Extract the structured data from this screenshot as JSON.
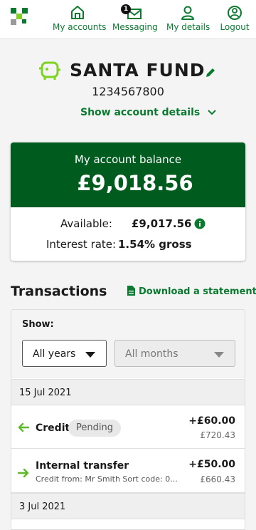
{
  "nav": {
    "items": [
      {
        "label": "My accounts",
        "icon": "home-icon"
      },
      {
        "label": "Messaging",
        "icon": "envelope-icon",
        "badge": "1"
      },
      {
        "label": "My details",
        "icon": "person-icon"
      },
      {
        "label": "Logout",
        "icon": "logout-icon"
      }
    ]
  },
  "account": {
    "name": "SANTA FUND",
    "number": "1234567800",
    "show_details": "Show account details"
  },
  "balance": {
    "label": "My account balance",
    "value": "£9,018.56",
    "available_label": "Available:",
    "available_value": "£9,017.56",
    "interest_label": "Interest rate:",
    "interest_value": "1.54% gross"
  },
  "transactions": {
    "title": "Transactions",
    "download": "Download a statement",
    "filter": {
      "show_label": "Show:",
      "years": "All years",
      "months": "All months"
    },
    "groups": [
      {
        "date": "15 Jul 2021",
        "items": [
          {
            "name": "Credit",
            "status": "Pending",
            "amount": "+£60.00",
            "balance": "£720.43"
          },
          {
            "name": "Internal transfer",
            "detail": "Credit from: Mr Smith Sort code: 0...",
            "amount": "+£50.00",
            "balance": "£660.43"
          }
        ]
      },
      {
        "date": "3 Jul 2021",
        "items": []
      }
    ]
  },
  "colors": {
    "brand_green": "#0a7a2f",
    "dark_green": "#005c1e",
    "logo_light": "#7ed321"
  }
}
